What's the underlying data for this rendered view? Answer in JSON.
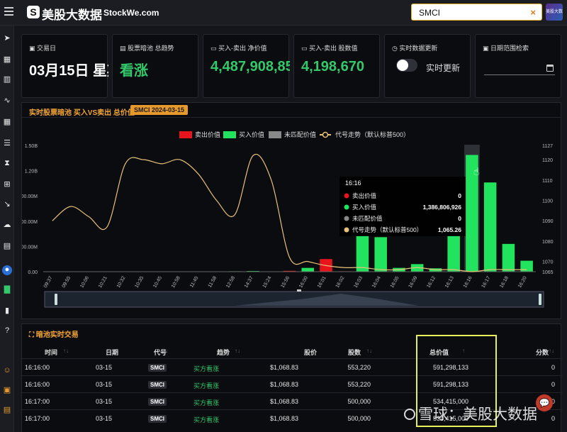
{
  "header": {
    "logo_mark": "S",
    "brand_cn": "美股大数据",
    "brand_en": "StockWe.com",
    "search_value": "SMCI",
    "clear": "×",
    "avatar_text": "美股大数据"
  },
  "sidebar": {
    "icons": [
      "rocket-icon",
      "grid-icon",
      "chart-bar-icon",
      "line-chart-icon",
      "calendar-icon",
      "list-icon",
      "hourglass-icon",
      "sitemap-icon",
      "trend-down-icon",
      "cloud-icon",
      "chart-area-icon",
      "globe-icon",
      "bar-green-icon",
      "bar-chart-icon",
      "help-icon",
      "users-icon",
      "building-icon",
      "book-icon"
    ]
  },
  "cards": {
    "trade_day": {
      "label": "交易日",
      "value": "03月15日 星期"
    },
    "dark_pool_trend": {
      "label": "股票暗池 总趋势",
      "value": "看涨"
    },
    "net_value": {
      "label": "买入-卖出 净价值",
      "value": "4,487,908,85"
    },
    "share_value": {
      "label": "买入-卖出 股数值",
      "value": "4,198,670"
    },
    "realtime": {
      "label": "实时数据更新",
      "toggle_label": "实时更新",
      "enabled": false
    },
    "date_range": {
      "label": "日期范围检索",
      "value": ""
    }
  },
  "chart_panel": {
    "title": "实时股票暗池 买入VS卖出 总价值",
    "badge": "SMCI 2024-03-15"
  },
  "chart_data": {
    "type": "bar",
    "colors": {
      "sell": "#e8141c",
      "buy": "#22e35d",
      "unmatched": "#888888",
      "line": "#e9c07a"
    },
    "legend": [
      "卖出价值",
      "买入价值",
      "未匹配价值",
      "代号走势（默认标普500）"
    ],
    "categories": [
      "09:37",
      "09:55",
      "10:06",
      "10:21",
      "10:32",
      "10:35",
      "10:45",
      "10:58",
      "11:45",
      "11:58",
      "12:58",
      "14:37",
      "15:24",
      "15:56",
      "16:00",
      "16:01",
      "16:02",
      "16:03",
      "16:04",
      "16:05",
      "16:09",
      "16:12",
      "16:13",
      "16:16",
      "16:17",
      "16:18",
      "16:20"
    ],
    "y_left_ticks": [
      "0.00",
      "00.00M",
      "00.00M",
      "00.00M",
      "1.20B",
      "1.50B"
    ],
    "y_right_ticks": [
      "1065",
      "1070",
      "1080",
      "1090",
      "1100",
      "1110",
      "1120",
      "1127"
    ],
    "ylim_left": [
      0,
      1500000000
    ],
    "ylim_right": [
      1065,
      1127
    ],
    "series": [
      {
        "name": "卖出价值",
        "values": [
          0,
          0,
          0,
          0,
          0,
          0,
          0,
          0,
          0,
          0,
          0,
          0,
          0,
          10000000,
          0,
          150000000,
          5000000,
          0,
          0,
          0,
          0,
          0,
          0,
          0,
          0,
          0,
          0
        ]
      },
      {
        "name": "买入价值",
        "values": [
          0,
          0,
          0,
          0,
          0,
          0,
          0,
          0,
          0,
          0,
          5000000,
          8000000,
          0,
          0,
          45000000,
          0,
          0,
          430000000,
          410000000,
          45000000,
          90000000,
          40000000,
          430000000,
          1386806926,
          1060000000,
          330000000,
          130000000
        ]
      },
      {
        "name": "代号走势（默认标普500）",
        "values": [
          1090,
          1097,
          1092,
          1087,
          1118,
          1120,
          1118,
          1120,
          1113,
          1100,
          1093,
          1122,
          1110,
          1072,
          1070,
          1068,
          1067,
          1067,
          1066,
          1066,
          1067,
          1066,
          1066,
          1065,
          1066,
          1066,
          1066
        ]
      }
    ],
    "tooltip": {
      "time": "16:16",
      "rows": [
        {
          "label": "卖出价值",
          "value": "0",
          "color": "#e8141c"
        },
        {
          "label": "买入价值",
          "value": "1,386,806,926",
          "color": "#22e35d"
        },
        {
          "label": "未匹配价值",
          "value": "0",
          "color": "#888888"
        },
        {
          "label": "代号走势（默认标普500）",
          "value": "1,065.26",
          "color": "#e9c07a"
        }
      ]
    }
  },
  "table": {
    "title": "暗池实时交易",
    "headers": [
      "时间",
      "日期",
      "代号",
      "趋势",
      "股价",
      "股数",
      "总价值",
      "分数"
    ],
    "rows": [
      {
        "time": "16:16:00",
        "date": "03-15",
        "symbol": "SMCI",
        "trend": "买方看涨",
        "price": "$1,068.83",
        "shares": "553,220",
        "total": "591,298,133",
        "score": "0"
      },
      {
        "time": "16:16:00",
        "date": "03-15",
        "symbol": "SMCI",
        "trend": "买方看涨",
        "price": "$1,068.83",
        "shares": "553,220",
        "total": "591,298,133",
        "score": "0"
      },
      {
        "time": "16:17:00",
        "date": "03-15",
        "symbol": "SMCI",
        "trend": "买方看涨",
        "price": "$1,068.83",
        "shares": "500,000",
        "total": "534,415,000",
        "score": "0"
      },
      {
        "time": "16:17:00",
        "date": "03-15",
        "symbol": "SMCI",
        "trend": "买方看涨",
        "price": "$1,068.83",
        "shares": "500,000",
        "total": "534,415,000",
        "score": "0"
      }
    ]
  },
  "watermark": "雪球：美股大数据"
}
